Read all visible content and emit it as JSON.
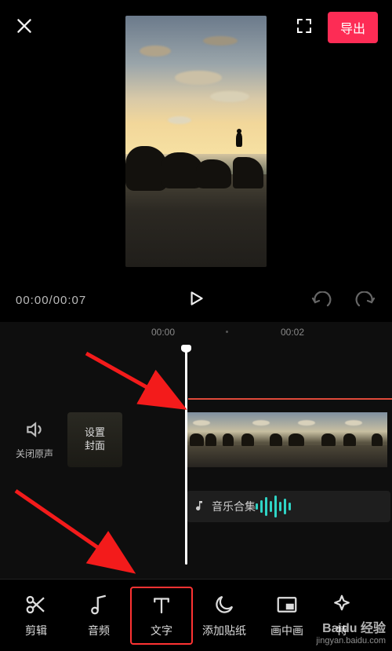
{
  "header": {
    "export_label": "导出"
  },
  "transport": {
    "timecode": "00:00/00:07"
  },
  "ruler": {
    "t0": "00:00",
    "t2": "00:02"
  },
  "tracks": {
    "mute_label": "关闭原声",
    "cover_label": "设置\n封面",
    "audio_label": "音乐合集"
  },
  "toolbar": {
    "items": [
      {
        "id": "edit",
        "label": "剪辑"
      },
      {
        "id": "audio",
        "label": "音频"
      },
      {
        "id": "text",
        "label": "文字"
      },
      {
        "id": "sticker",
        "label": "添加贴纸"
      },
      {
        "id": "pip",
        "label": "画中画"
      },
      {
        "id": "effects",
        "label": "特"
      }
    ],
    "active_index": 2
  },
  "watermark": {
    "brand": "Baidu 经验",
    "url": "jingyan.baidu.com"
  }
}
